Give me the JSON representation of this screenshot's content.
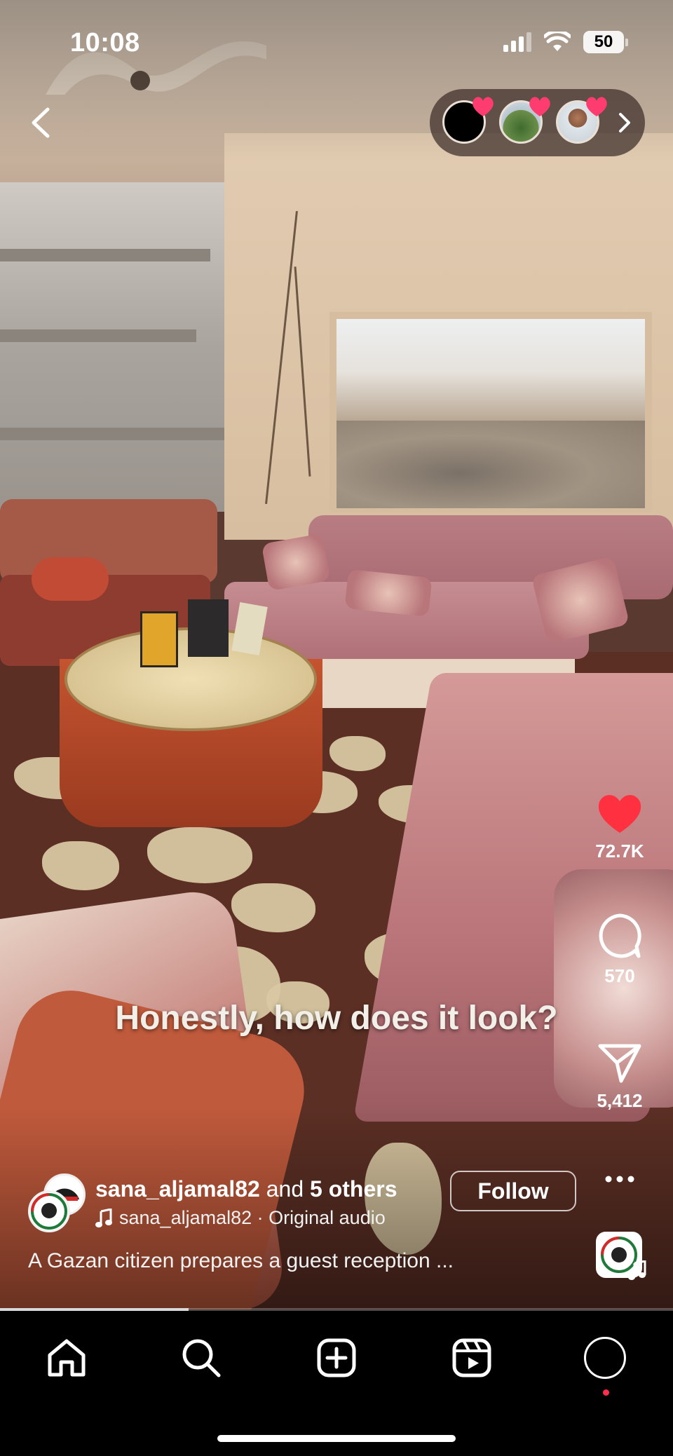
{
  "status_bar": {
    "time": "10:08",
    "battery_level": "50",
    "icons": [
      "cellular-signal-icon",
      "wifi-icon",
      "battery-icon"
    ]
  },
  "top_nav": {
    "back_icon": "chevron-left-icon",
    "stories": {
      "avatars": [
        "story-avatar-1",
        "story-avatar-2",
        "story-avatar-3"
      ],
      "badge_icon": "heart-icon",
      "expand_icon": "chevron-right-icon"
    }
  },
  "actions": {
    "like": {
      "icon": "heart-filled-icon",
      "count": "72.7K",
      "color": "#ff3040"
    },
    "comment": {
      "icon": "comment-bubble-icon",
      "count": "570"
    },
    "share": {
      "icon": "paper-plane-icon",
      "count": "5,412"
    },
    "more": {
      "icon": "more-horizontal-icon"
    }
  },
  "overlay_text": "Honestly, how does it look?",
  "author": {
    "username": "sana_aljamal82",
    "and_text": "and",
    "others": "5 others",
    "follow_label": "Follow",
    "audio_icon": "music-note-icon",
    "audio_text": "sana_aljamal82 · Original audio"
  },
  "description": "A Gazan citizen prepares a guest reception ...",
  "progress": {
    "fraction": 0.28
  },
  "tabbar": {
    "items": [
      "home-icon",
      "search-icon",
      "create-icon",
      "reels-icon",
      "profile-icon"
    ],
    "active": "reels"
  }
}
